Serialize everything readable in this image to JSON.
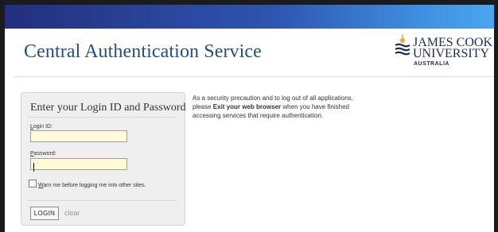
{
  "header": {
    "title": "Central Authentication Service",
    "logo": {
      "line1": "JAMES COOK",
      "line2": "UNIVERSITY",
      "line3": "AUSTRALIA"
    }
  },
  "login": {
    "heading": "Enter your Login ID and Password",
    "login_id": {
      "label_access_key": "L",
      "label_rest": "ogin ID:",
      "value": ""
    },
    "password": {
      "label_access_key": "P",
      "label_rest": "assword:",
      "value": ""
    },
    "warn": {
      "checked": false,
      "label_access_key": "W",
      "label_rest": "arn me before logging me into other sites."
    },
    "submit_label": "LOGIN",
    "clear_label": "clear"
  },
  "notice": {
    "part1": "As a security precaution and to log out of all applications, please ",
    "emphasis": "Exit your web browser",
    "part2": " when you have finished accessing services that require authentication."
  },
  "colors": {
    "title": "#1f4e8c",
    "input_bg": "#fefbd6",
    "box_bg": "#efefef",
    "bar_start": "#232f7d",
    "bar_end": "#4aa6ee"
  }
}
